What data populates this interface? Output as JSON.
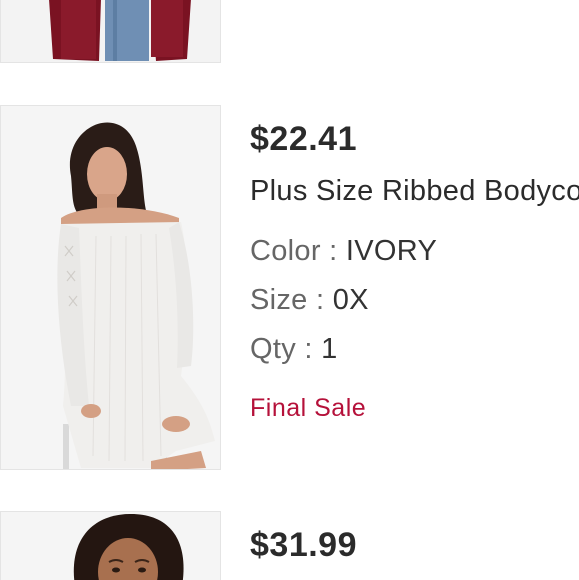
{
  "cart_items": [
    {
      "image_desc": "Person in burgundy cardigan and jeans"
    },
    {
      "price": "$22.41",
      "name": "Plus Size Ribbed Bodycon Dress",
      "color_label": "Color",
      "color_value": "IVORY",
      "size_label": "Size",
      "size_value": "0X",
      "qty_label": "Qty",
      "qty_value": "1",
      "sale_tag": "Final Sale",
      "image_desc": "Model wearing ivory off-shoulder ribbed dress with lace-up sleeves"
    },
    {
      "price": "$31.99",
      "image_desc": "Model with curly dark hair"
    }
  ],
  "colors": {
    "sale_red": "#b5113a",
    "text_dark": "#2b2b2b",
    "text_gray": "#666666"
  }
}
